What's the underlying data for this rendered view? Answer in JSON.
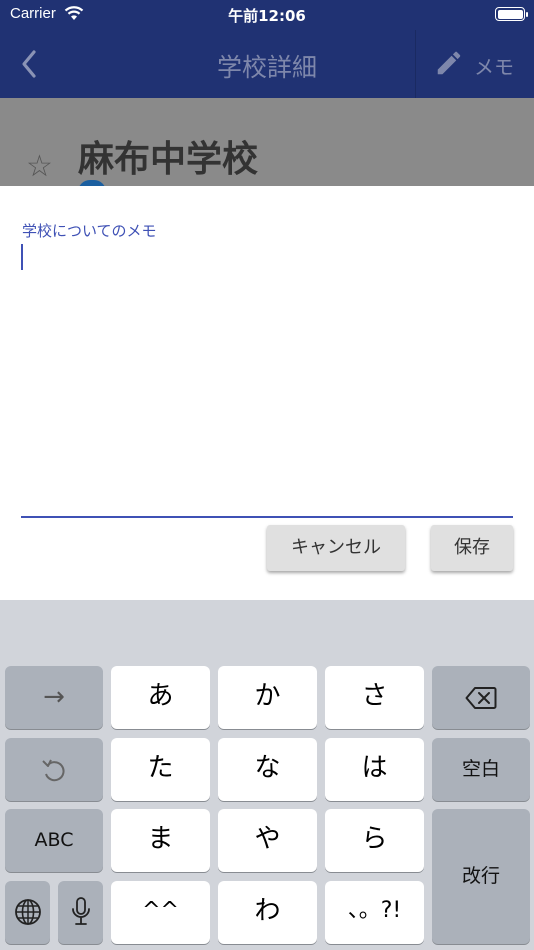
{
  "status_bar": {
    "carrier": "Carrier",
    "time": "午前12:06",
    "battery_level": 1.0
  },
  "app_bar": {
    "title": "学校詳細",
    "memo_label": "メモ",
    "icons": {
      "back": "back-chevron-icon",
      "memo": "pencil-icon"
    }
  },
  "page": {
    "school_name": "麻布中学校",
    "favorite_icon": "star-outline-icon"
  },
  "memo_dialog": {
    "field_label": "学校についてのメモ",
    "field_value": "",
    "cancel_label": "キャンセル",
    "save_label": "保存",
    "accent_color": "#3f51b5"
  },
  "keyboard": {
    "row1": {
      "left": "→",
      "keys": [
        "あ",
        "か",
        "さ"
      ],
      "right_icon": "backspace-icon"
    },
    "row2": {
      "left_icon": "undo-icon",
      "keys": [
        "た",
        "な",
        "は"
      ],
      "right": "空白"
    },
    "row3": {
      "left": "ABC",
      "keys": [
        "ま",
        "や",
        "ら"
      ],
      "right": "改行"
    },
    "row4": {
      "globe_icon": "globe-icon",
      "mic_icon": "microphone-icon",
      "keys": [
        "^^",
        "わ",
        "、。?!"
      ]
    }
  }
}
